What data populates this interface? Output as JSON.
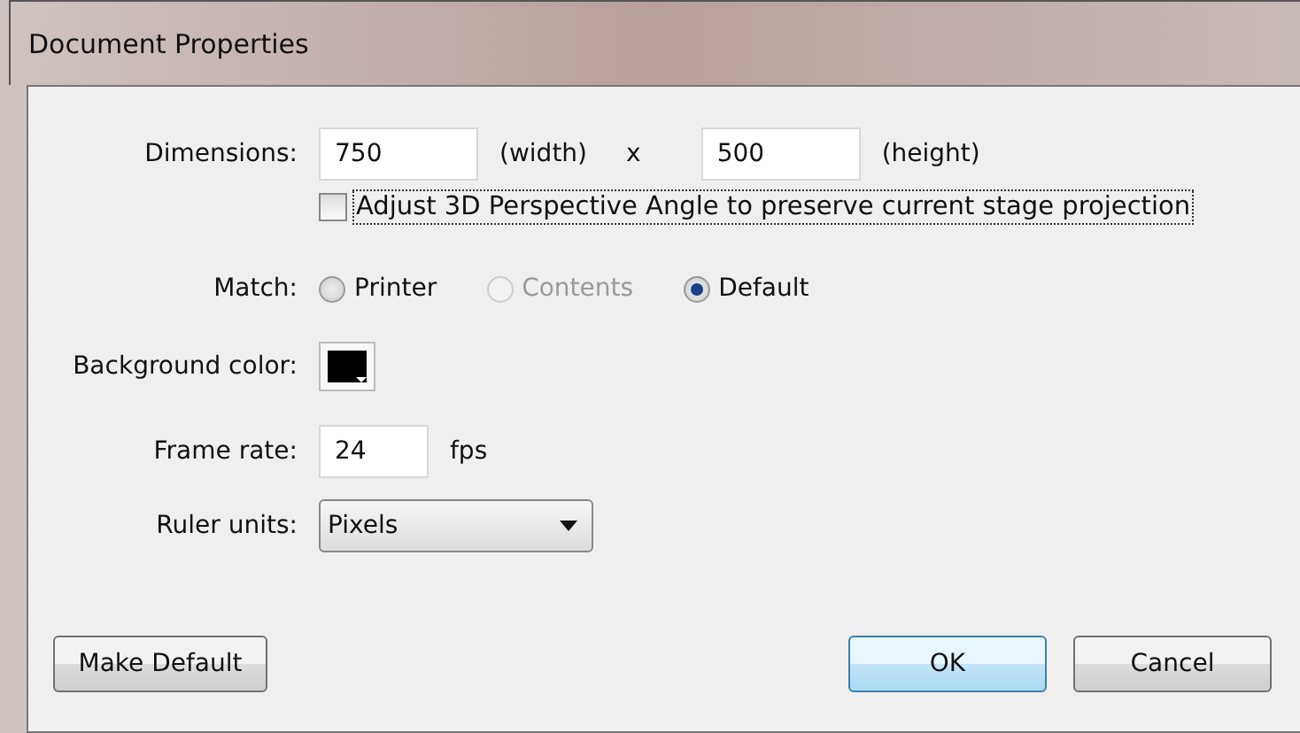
{
  "window": {
    "title": "Document Properties"
  },
  "dimensions": {
    "label": "Dimensions:",
    "width": {
      "value": "750",
      "unit": "(width)"
    },
    "separator": "x",
    "height": {
      "value": "500",
      "unit": "(height)"
    }
  },
  "perspective": {
    "label": "Adjust 3D Perspective Angle to preserve current stage projection",
    "checked": false
  },
  "match": {
    "label": "Match:",
    "options": [
      {
        "label": "Printer",
        "selected": false,
        "disabled": false
      },
      {
        "label": "Contents",
        "selected": false,
        "disabled": true
      },
      {
        "label": "Default",
        "selected": true,
        "disabled": false
      }
    ]
  },
  "background": {
    "label": "Background color:",
    "color": "#000000"
  },
  "frame_rate": {
    "label": "Frame rate:",
    "value": "24",
    "unit": "fps"
  },
  "ruler_units": {
    "label": "Ruler units:",
    "value": "Pixels"
  },
  "buttons": [
    {
      "label": "Make Default",
      "kind": "secondary"
    },
    {
      "label": "OK",
      "kind": "default"
    },
    {
      "label": "Cancel",
      "kind": "secondary"
    }
  ]
}
